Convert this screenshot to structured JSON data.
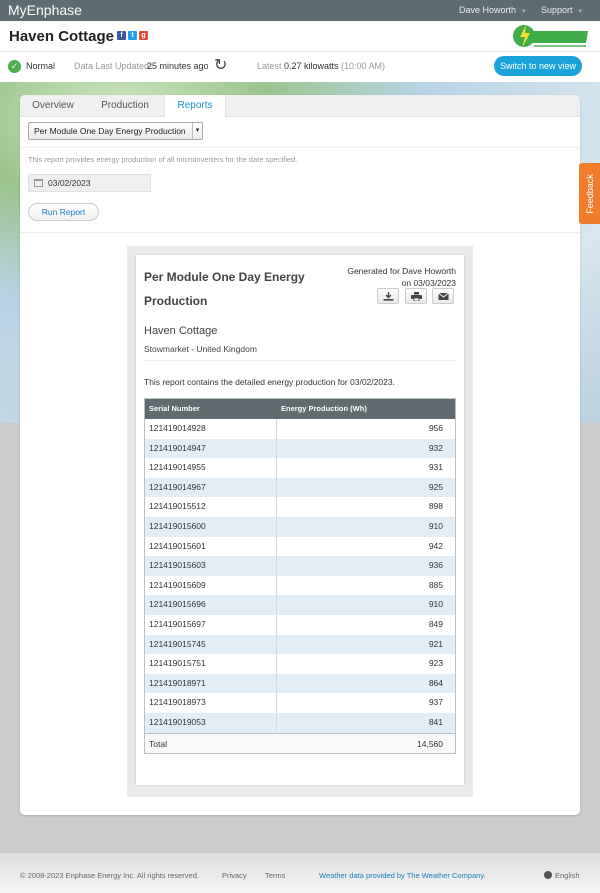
{
  "topbar": {
    "brand": "MyEnphase",
    "user_menu": "Dave Howorth",
    "support_menu": "Support"
  },
  "site": {
    "name": "Haven Cottage",
    "social": [
      "facebook-icon",
      "twitter-icon",
      "google-plus-icon"
    ]
  },
  "status": {
    "state": "Normal",
    "last_updated_label": "Data Last Updated:",
    "last_updated_value": "25 minutes ago",
    "latest_label": "Latest",
    "latest_value": "0.27 kilowatts",
    "latest_time": "(10:00 AM)",
    "switch_label": "Switch to new view",
    "colors": {
      "ok": "#4caf50",
      "accent": "#19a3d9"
    }
  },
  "tabs": [
    {
      "label": "Overview"
    },
    {
      "label": "Production"
    },
    {
      "label": "Reports"
    }
  ],
  "controls": {
    "report_type": "Per Module One Day Energy Production",
    "description": "This report provides energy production of all microinverters for the date specified.",
    "date": "03/02/2023",
    "run_label": "Run Report"
  },
  "report": {
    "title": "Per Module One Day Energy Production",
    "generated_by": "Generated for Dave Howorth",
    "generated_on": "on 03/03/2023",
    "site_name": "Haven Cottage",
    "location": "Stowmarket - United Kingdom",
    "note": "This report contains the detailed energy production for 03/02/2023.",
    "columns": [
      "Serial Number",
      "Energy Production (Wh)"
    ],
    "rows": [
      {
        "serial": "121419014928",
        "wh": "956"
      },
      {
        "serial": "121419014947",
        "wh": "932"
      },
      {
        "serial": "121419014955",
        "wh": "931"
      },
      {
        "serial": "121419014967",
        "wh": "925"
      },
      {
        "serial": "121419015512",
        "wh": "898"
      },
      {
        "serial": "121419015600",
        "wh": "910"
      },
      {
        "serial": "121419015601",
        "wh": "942"
      },
      {
        "serial": "121419015603",
        "wh": "936"
      },
      {
        "serial": "121419015609",
        "wh": "885"
      },
      {
        "serial": "121419015696",
        "wh": "910"
      },
      {
        "serial": "121419015697",
        "wh": "849"
      },
      {
        "serial": "121419015745",
        "wh": "921"
      },
      {
        "serial": "121419015751",
        "wh": "923"
      },
      {
        "serial": "121419018971",
        "wh": "864"
      },
      {
        "serial": "121419018973",
        "wh": "937"
      },
      {
        "serial": "121419019053",
        "wh": "841"
      }
    ],
    "total_label": "Total",
    "total_value": "14,560"
  },
  "feedback": "Feedback",
  "footer": {
    "copyright": "© 2008-2023 Enphase Energy Inc. All rights reserved.",
    "privacy": "Privacy",
    "terms": "Terms",
    "weather": "Weather data provided by The Weather Company.",
    "language": "English"
  }
}
